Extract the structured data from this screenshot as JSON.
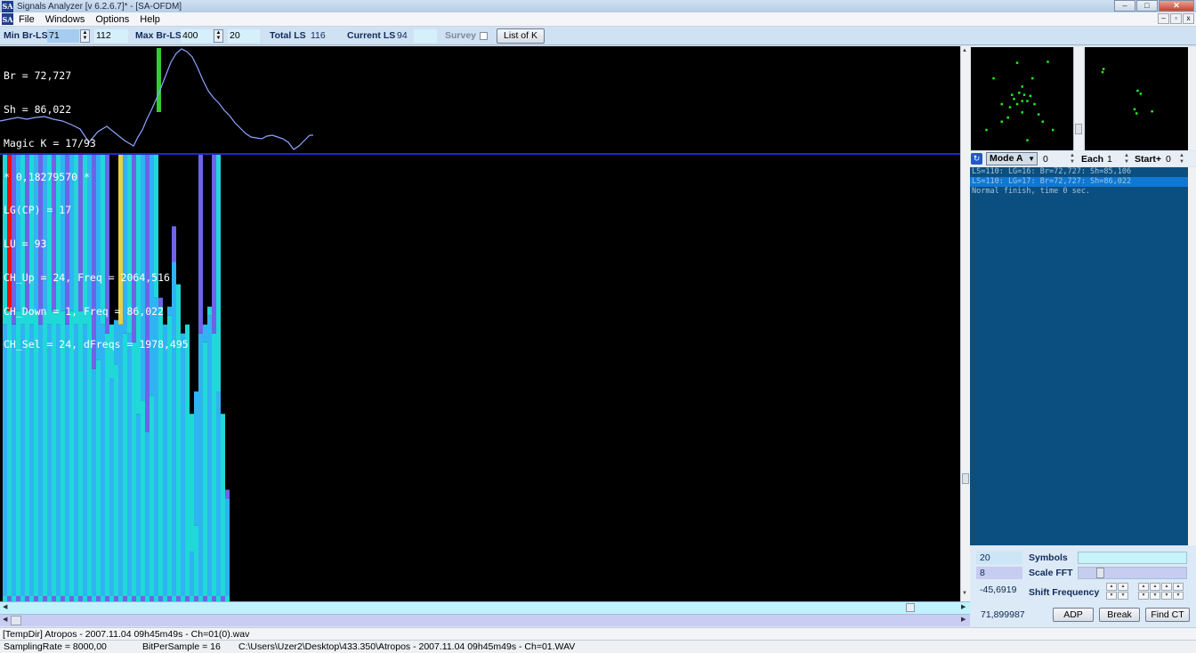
{
  "window": {
    "title": "Signals Analyzer [v 6.2.6.7]* - [SA-OFDM]",
    "app_icon": "SA",
    "controls": [
      "–",
      "□",
      "✕"
    ]
  },
  "menu": {
    "items": [
      "File",
      "Windows",
      "Options",
      "Help"
    ],
    "mdi_controls": [
      "–",
      "▫",
      "x"
    ]
  },
  "toolbar": {
    "min_br_ls_label": "Min Br-LS",
    "min_br_ls_value": "71",
    "min_br_ls_second": "112",
    "max_br_ls_label": "Max Br-LS",
    "max_br_ls_value": "400",
    "max_br_ls_second": "20",
    "total_ls_label": "Total LS",
    "total_ls_value": "116",
    "current_ls_label": "Current LS",
    "current_ls_value": "94",
    "survey_label": "Survey",
    "list_of_k_label": "List of K"
  },
  "overlay": {
    "lines": [
      "Br = 72,727",
      "Sh = 86,022",
      "Magic K = 17/93",
      "* 0,18279570 *",
      "LG(CP) = 17",
      "LU = 93",
      "CH_Up = 24, Freq = 2064,516",
      "CH_Down = 1, Freq = 86,022",
      "CH_Sel = 24, dFreqs = 1978,495"
    ]
  },
  "colors": {
    "plot_bg": "#000000",
    "spectrum_line": "#8fa3ff",
    "marker_green": "#33cc33",
    "divider": "#1a2acc",
    "bar_blue": "#2fb3f2",
    "bar_cyan": "#20d8d8",
    "bar_purple": "#6d64e8",
    "bar_red": "#ee1010",
    "bar_yellow": "#e8d040",
    "constellation_points": "#22ee22"
  },
  "bars": {
    "levels": [
      0.62,
      0.65,
      0.62,
      0.65,
      0.62,
      0.65,
      0.62,
      0.65,
      0.62,
      0.65,
      0.62,
      0.65,
      0.62,
      0.65,
      0.62,
      0.65,
      0.62,
      0.65,
      0.62,
      0.65,
      0.52,
      0.54,
      0.62,
      0.6,
      0.5,
      0.53,
      0.62,
      0.6,
      0.6,
      0.58,
      0.42,
      0.45,
      0.38,
      0.46,
      0.68,
      0.66,
      0.62,
      0.64,
      0.76,
      0.71,
      0.6,
      0.62,
      0.11,
      0.17,
      0.6,
      0.58,
      0.64,
      0.6,
      0.47,
      0.42,
      0.23
    ],
    "tops": [
      1,
      1,
      1,
      1,
      1,
      1,
      1,
      1,
      1,
      1,
      1,
      1,
      1,
      1,
      1,
      1,
      1,
      1,
      1,
      1,
      1,
      1,
      1,
      1,
      0.62,
      0.63,
      1,
      1,
      1,
      1,
      1,
      1,
      1,
      1,
      1,
      0.68,
      0.62,
      0.66,
      0.84,
      0.71,
      0.6,
      0.62,
      0.42,
      0.47,
      1,
      0.62,
      0.66,
      1,
      1,
      0.34,
      0.25
    ],
    "special": [
      {
        "index": 1,
        "color": "red"
      },
      {
        "index": 26,
        "color": "yellow"
      }
    ]
  },
  "spectrum": {
    "marker_x_fraction": 0.165
  },
  "constellation": {
    "left_points": [
      [
        0.45,
        0.15
      ],
      [
        0.75,
        0.14
      ],
      [
        0.22,
        0.3
      ],
      [
        0.6,
        0.3
      ],
      [
        0.3,
        0.55
      ],
      [
        0.15,
        0.8
      ],
      [
        0.8,
        0.8
      ],
      [
        0.55,
        0.9
      ],
      [
        0.42,
        0.5
      ],
      [
        0.52,
        0.46
      ],
      [
        0.5,
        0.52
      ],
      [
        0.47,
        0.44
      ],
      [
        0.55,
        0.52
      ],
      [
        0.45,
        0.55
      ],
      [
        0.58,
        0.47
      ],
      [
        0.4,
        0.46
      ],
      [
        0.62,
        0.55
      ],
      [
        0.38,
        0.58
      ],
      [
        0.5,
        0.63
      ],
      [
        0.5,
        0.38
      ],
      [
        0.36,
        0.68
      ],
      [
        0.66,
        0.65
      ],
      [
        0.3,
        0.72
      ],
      [
        0.7,
        0.72
      ]
    ],
    "right_points": [
      [
        0.17,
        0.24
      ],
      [
        0.18,
        0.21
      ],
      [
        0.48,
        0.6
      ],
      [
        0.5,
        0.64
      ],
      [
        0.54,
        0.45
      ],
      [
        0.51,
        0.42
      ],
      [
        0.65,
        0.62
      ]
    ]
  },
  "mode_row": {
    "mode": "Mode A",
    "mode_value": "0",
    "each_label": "Each",
    "each_value": "1",
    "start_label": "Start+",
    "start_value": "0"
  },
  "log": {
    "lines": [
      {
        "text": "LS=110: LG=16: Br=72,727: Sh=85,106",
        "selected": false
      },
      {
        "text": "LS=110: LG=17: Br=72,727: Sh=86,022",
        "selected": true
      },
      {
        "text": "Normal finish, time 0 sec.",
        "selected": false
      }
    ]
  },
  "params": {
    "symbols_value": "20",
    "symbols_label": "Symbols",
    "scale_fft_value": "8",
    "scale_fft_label": "Scale FFT",
    "shift_freq_value": "-45,6919",
    "shift_freq_label": "Shift Frequency",
    "freq_value": "71,899987"
  },
  "buttons": {
    "adp": "ADP",
    "break": "Break",
    "find_ct": "Find CT"
  },
  "status": {
    "file_line": "[TempDir] Atropos - 2007.11.04 09h45m49s - Ch=01(0).wav",
    "sampling_rate": "SamplingRate = 8000,00",
    "bits_per_sample": "BitPerSample = 16",
    "file_path": "C:\\Users\\Uzer2\\Desktop\\433.350\\Atropos - 2007.11.04 09h45m49s - Ch=01.WAV"
  }
}
